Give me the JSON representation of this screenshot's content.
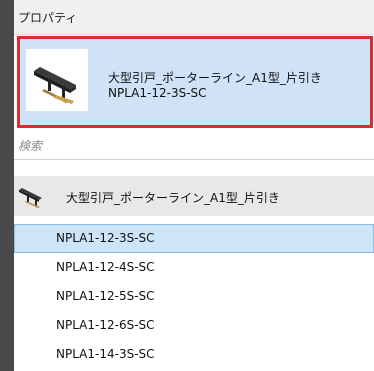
{
  "panel": {
    "title": "プロパティ"
  },
  "type_selector": {
    "family_name": "大型引戸_ポーターライン_A1型_片引き",
    "type_name": "NPLA1-12-3S-SC"
  },
  "search": {
    "placeholder": "検索"
  },
  "family_group": {
    "name": "大型引戸_ポーターライン_A1型_片引き"
  },
  "types": [
    {
      "label": "NPLA1-12-3S-SC",
      "selected": true
    },
    {
      "label": "NPLA1-12-4S-SC",
      "selected": false
    },
    {
      "label": "NPLA1-12-5S-SC",
      "selected": false
    },
    {
      "label": "NPLA1-12-6S-SC",
      "selected": false
    },
    {
      "label": "NPLA1-14-3S-SC",
      "selected": false
    }
  ],
  "colors": {
    "selection_fill": "#cce6f8",
    "selector_fill": "#cfe2f7",
    "highlight_border": "#d82e2e"
  }
}
